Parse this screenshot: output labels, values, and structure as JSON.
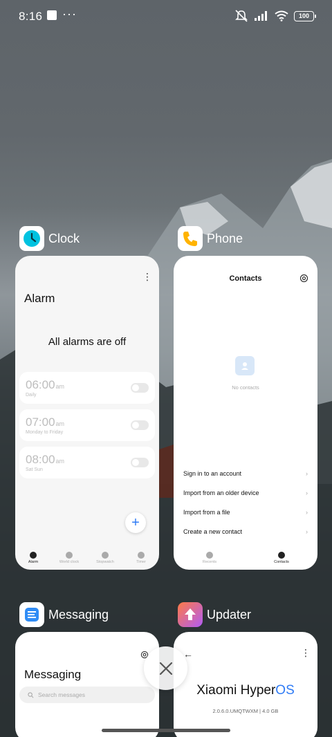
{
  "status_bar": {
    "time": "8:16",
    "more": "···",
    "battery": "100"
  },
  "recents": {
    "clock": {
      "app_name": "Clock",
      "title": "Alarm",
      "empty_message": "All alarms are off",
      "alarms": [
        {
          "time": "06:00",
          "ampm": "am",
          "repeat": "Daily"
        },
        {
          "time": "07:00",
          "ampm": "am",
          "repeat": "Monday to Friday"
        },
        {
          "time": "08:00",
          "ampm": "am",
          "repeat": "Sat Sun"
        }
      ],
      "tabs": [
        "Alarm",
        "World clock",
        "Stopwatch",
        "Timer"
      ]
    },
    "phone": {
      "app_name": "Phone",
      "title": "Contacts",
      "empty_text": "No contacts",
      "actions": [
        "Sign in to an account",
        "Import from an older device",
        "Import from a file",
        "Create a new contact"
      ],
      "tabs": [
        "Recents",
        "Contacts"
      ]
    },
    "messaging": {
      "app_name": "Messaging",
      "title": "Messaging",
      "search_placeholder": "Search messages"
    },
    "updater": {
      "app_name": "Updater",
      "brand": "Xiaomi Hyper",
      "brand_accent": "OS",
      "version": "2.0.6.0.UMQTWXM | 4.0 GB"
    }
  },
  "colors": {
    "accent": "#2f7bf5",
    "clock_icon": "#00b8d4",
    "phone_icon": "#ffb300",
    "updater_icon": "#ff6f4f"
  }
}
